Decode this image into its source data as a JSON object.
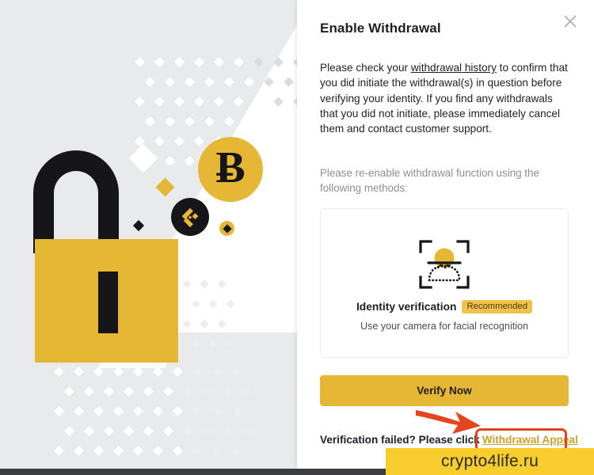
{
  "modal": {
    "title": "Enable Withdrawal",
    "close_icon": "close-icon",
    "paragraph_1_before": "Please check your ",
    "paragraph_1_link": "withdrawal history",
    "paragraph_1_after": " to confirm that you did initiate the withdrawal(s) in question before verifying your identity. If you find any withdrawals that you did not initiate, please immediately cancel them and contact customer support.",
    "paragraph_2": "Please re-enable withdrawal function using the following methods:",
    "method": {
      "icon": "face-scan-icon",
      "title": "Identity verification",
      "badge": "Recommended",
      "subtitle": "Use your camera for facial recognition"
    },
    "primary_button": "Verify Now",
    "failure_text": "Verification failed? Please click",
    "failure_link": "Withdrawal Appeal"
  },
  "illustration": {
    "lock_icon": "padlock-icon",
    "bitcoin_icon": "bitcoin-coin-icon",
    "bitcoin_symbol": "Ƀ",
    "binance_icon": "binance-logo-icon"
  },
  "annotation": {
    "arrow_icon": "red-arrow-icon",
    "highlight_box": "red-highlight-box",
    "color": "#d9471f"
  },
  "watermark": {
    "text": "crypto4life.ru",
    "background": "#f8cd2d"
  },
  "colors": {
    "brand_yellow": "#e6b735",
    "badge_yellow": "#f0c14b",
    "dark": "#1e2026",
    "muted": "#8c8f96",
    "panel_grey": "#e9eaeb"
  }
}
